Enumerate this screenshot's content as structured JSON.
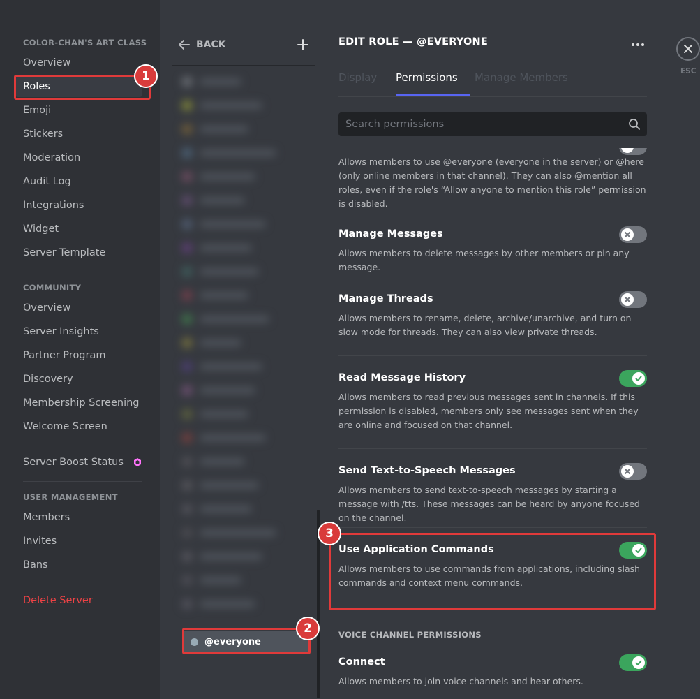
{
  "sidebar": {
    "server_name": "COLOR-CHAN'S ART CLASS",
    "items": [
      {
        "label": "Overview"
      },
      {
        "label": "Roles"
      },
      {
        "label": "Emoji"
      },
      {
        "label": "Stickers"
      },
      {
        "label": "Moderation"
      },
      {
        "label": "Audit Log"
      },
      {
        "label": "Integrations"
      },
      {
        "label": "Widget"
      },
      {
        "label": "Server Template"
      }
    ],
    "community_header": "COMMUNITY",
    "community_items": [
      {
        "label": "Overview"
      },
      {
        "label": "Server Insights"
      },
      {
        "label": "Partner Program"
      },
      {
        "label": "Discovery"
      },
      {
        "label": "Membership Screening"
      },
      {
        "label": "Welcome Screen"
      }
    ],
    "boost_status": "Server Boost Status",
    "user_mgmt_header": "USER MANAGEMENT",
    "user_mgmt_items": [
      {
        "label": "Members"
      },
      {
        "label": "Invites"
      },
      {
        "label": "Bans"
      }
    ],
    "delete_server": "Delete Server"
  },
  "roles_panel": {
    "back_label": "BACK",
    "everyone_role": "@everyone"
  },
  "main": {
    "title": "EDIT ROLE — @EVERYONE",
    "tabs": [
      {
        "label": "Display"
      },
      {
        "label": "Permissions"
      },
      {
        "label": "Manage Members"
      }
    ],
    "search_placeholder": "Search permissions",
    "partial_desc": "Allows members to use @everyone (everyone in the server) or @here (only online members in that channel). They can also @mention all roles, even if the role's “Allow anyone to mention this role” permission is disabled.",
    "permissions": [
      {
        "name": "Manage Messages",
        "desc": "Allows members to delete messages by other members or pin any message.",
        "enabled": false
      },
      {
        "name": "Manage Threads",
        "desc": "Allows members to rename, delete, archive/unarchive, and turn on slow mode for threads. They can also view private threads.",
        "enabled": false
      },
      {
        "name": "Read Message History",
        "desc": "Allows members to read previous messages sent in channels. If this permission is disabled, members only see messages sent when they are online and focused on that channel.",
        "enabled": true
      },
      {
        "name": "Send Text-to-Speech Messages",
        "desc": "Allows members to send text-to-speech messages by starting a message with /tts. These messages can be heard by anyone focused on the channel.",
        "enabled": false
      },
      {
        "name": "Use Application Commands",
        "desc": "Allows members to use commands from applications, including slash commands and context menu commands.",
        "enabled": true
      }
    ],
    "voice_header": "VOICE CHANNEL PERMISSIONS",
    "voice_permissions": [
      {
        "name": "Connect",
        "desc": "Allows members to join voice channels and hear others.",
        "enabled": true
      }
    ]
  },
  "close": {
    "esc_label": "ESC"
  },
  "annotations": {
    "badges": [
      "1",
      "2",
      "3"
    ]
  },
  "colors": {
    "accent": "#5865f2",
    "toggle_on": "#3ba55d",
    "toggle_off": "#72767d",
    "danger": "#ed4245",
    "highlight": "#e03a3a"
  }
}
